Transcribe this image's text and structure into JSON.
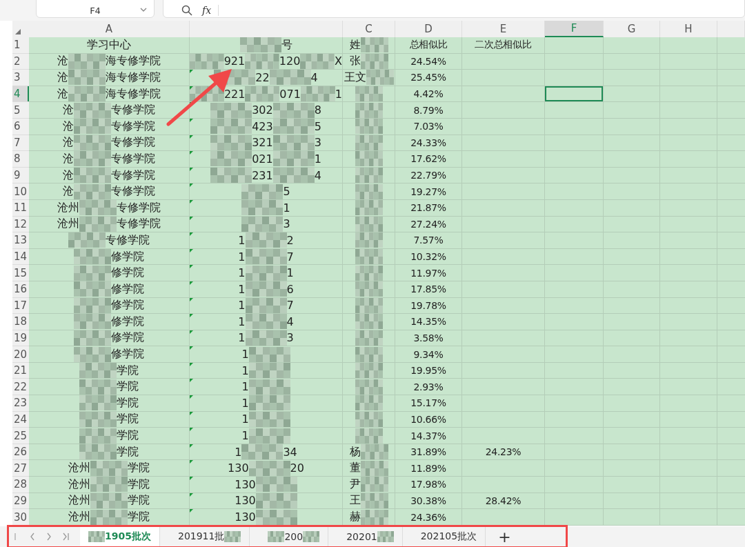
{
  "toolbar": {
    "name_box": "F4",
    "formula_label": "fx"
  },
  "columns": [
    {
      "label": "A",
      "selected": false
    },
    {
      "selected": false
    },
    {
      "label": "C",
      "selected": false
    },
    {
      "label": "D",
      "selected": false
    },
    {
      "label": "E",
      "selected": false
    },
    {
      "label": "F",
      "selected": true
    },
    {
      "label": "G",
      "selected": false
    },
    {
      "label": "H",
      "selected": false
    }
  ],
  "rows": [
    {
      "num": "1",
      "selected": false,
      "flag": false,
      "a": [
        {
          "kind": "text",
          "text": "学习中心"
        }
      ],
      "b": [
        {
          "kind": "mosaic"
        },
        {
          "kind": "text",
          "text": "号"
        }
      ],
      "c": [
        {
          "kind": "text",
          "text": "姓"
        },
        {
          "kind": "mosaic"
        }
      ],
      "d": "总相似比",
      "e": "二次总相似比"
    },
    {
      "num": "2",
      "selected": false,
      "flag": false,
      "a": [
        {
          "kind": "text",
          "text": "沧"
        },
        {
          "kind": "mosaic"
        },
        {
          "kind": "text",
          "text": "海专修学院"
        }
      ],
      "b": [
        {
          "kind": "mosaic"
        },
        {
          "kind": "text",
          "text": "921"
        },
        {
          "kind": "mosaic"
        },
        {
          "kind": "text",
          "text": "120"
        },
        {
          "kind": "mosaic"
        },
        {
          "kind": "text",
          "text": "X"
        }
      ],
      "c": [
        {
          "kind": "text",
          "text": "张"
        },
        {
          "kind": "mosaic"
        }
      ],
      "d": "24.54%"
    },
    {
      "num": "3",
      "selected": false,
      "flag": true,
      "a": [
        {
          "kind": "text",
          "text": "沧"
        },
        {
          "kind": "mosaic"
        },
        {
          "kind": "text",
          "text": "海专修学院"
        }
      ],
      "b": [
        {
          "kind": "mosaic"
        },
        {
          "kind": "text",
          "text": "22"
        },
        {
          "kind": "mosaic"
        },
        {
          "kind": "text",
          "text": "4"
        }
      ],
      "c": [
        {
          "kind": "text",
          "text": "王文"
        },
        {
          "kind": "mosaic"
        }
      ],
      "d": "25.45%"
    },
    {
      "num": "4",
      "selected": true,
      "flag": true,
      "a": [
        {
          "kind": "text",
          "text": "沧"
        },
        {
          "kind": "mosaic"
        },
        {
          "kind": "text",
          "text": "海专修学院"
        }
      ],
      "b": [
        {
          "kind": "mosaic"
        },
        {
          "kind": "text",
          "text": "221"
        },
        {
          "kind": "mosaic"
        },
        {
          "kind": "text",
          "text": "071"
        },
        {
          "kind": "mosaic"
        },
        {
          "kind": "text",
          "text": "1"
        }
      ],
      "c": [
        {
          "kind": "mosaic"
        }
      ],
      "d": "4.42%"
    },
    {
      "num": "5",
      "selected": false,
      "flag": true,
      "a": [
        {
          "kind": "text",
          "text": "沧"
        },
        {
          "kind": "mosaic"
        },
        {
          "kind": "text",
          "text": "专修学院"
        }
      ],
      "b": [
        {
          "kind": "mosaic"
        },
        {
          "kind": "text",
          "text": "302"
        },
        {
          "kind": "mosaic"
        },
        {
          "kind": "text",
          "text": "8"
        }
      ],
      "c": [
        {
          "kind": "mosaic"
        }
      ],
      "d": "8.79%"
    },
    {
      "num": "6",
      "selected": false,
      "flag": true,
      "a": [
        {
          "kind": "text",
          "text": "沧"
        },
        {
          "kind": "mosaic"
        },
        {
          "kind": "text",
          "text": "专修学院"
        }
      ],
      "b": [
        {
          "kind": "mosaic"
        },
        {
          "kind": "text",
          "text": "423"
        },
        {
          "kind": "mosaic"
        },
        {
          "kind": "text",
          "text": "5"
        }
      ],
      "c": [
        {
          "kind": "mosaic"
        }
      ],
      "d": "7.03%"
    },
    {
      "num": "7",
      "selected": false,
      "flag": true,
      "a": [
        {
          "kind": "text",
          "text": "沧"
        },
        {
          "kind": "mosaic"
        },
        {
          "kind": "text",
          "text": "专修学院"
        }
      ],
      "b": [
        {
          "kind": "mosaic"
        },
        {
          "kind": "text",
          "text": "321"
        },
        {
          "kind": "mosaic"
        },
        {
          "kind": "text",
          "text": "3"
        }
      ],
      "c": [
        {
          "kind": "mosaic"
        }
      ],
      "d": "24.33%"
    },
    {
      "num": "8",
      "selected": false,
      "flag": true,
      "a": [
        {
          "kind": "text",
          "text": "沧"
        },
        {
          "kind": "mosaic"
        },
        {
          "kind": "text",
          "text": "专修学院"
        }
      ],
      "b": [
        {
          "kind": "mosaic"
        },
        {
          "kind": "text",
          "text": "021"
        },
        {
          "kind": "mosaic"
        },
        {
          "kind": "text",
          "text": "1"
        }
      ],
      "c": [
        {
          "kind": "mosaic"
        }
      ],
      "d": "17.62%"
    },
    {
      "num": "9",
      "selected": false,
      "flag": true,
      "a": [
        {
          "kind": "text",
          "text": "沧"
        },
        {
          "kind": "mosaic"
        },
        {
          "kind": "text",
          "text": "专修学院"
        }
      ],
      "b": [
        {
          "kind": "mosaic"
        },
        {
          "kind": "text",
          "text": "231"
        },
        {
          "kind": "mosaic"
        },
        {
          "kind": "text",
          "text": "4"
        }
      ],
      "c": [
        {
          "kind": "mosaic"
        }
      ],
      "d": "22.79%"
    },
    {
      "num": "10",
      "selected": false,
      "flag": true,
      "a": [
        {
          "kind": "text",
          "text": "沧"
        },
        {
          "kind": "mosaic"
        },
        {
          "kind": "text",
          "text": "专修学院"
        }
      ],
      "b": [
        {
          "kind": "mosaic"
        },
        {
          "kind": "text",
          "text": "5"
        }
      ],
      "c": [
        {
          "kind": "mosaic"
        }
      ],
      "d": "19.27%"
    },
    {
      "num": "11",
      "selected": false,
      "flag": true,
      "a": [
        {
          "kind": "text",
          "text": "沧州"
        },
        {
          "kind": "mosaic"
        },
        {
          "kind": "text",
          "text": "专修学院"
        }
      ],
      "b": [
        {
          "kind": "mosaic"
        },
        {
          "kind": "text",
          "text": "1"
        }
      ],
      "c": [
        {
          "kind": "mosaic"
        }
      ],
      "d": "21.87%"
    },
    {
      "num": "12",
      "selected": false,
      "flag": true,
      "a": [
        {
          "kind": "text",
          "text": "沧州"
        },
        {
          "kind": "mosaic"
        },
        {
          "kind": "text",
          "text": "专修学院"
        }
      ],
      "b": [
        {
          "kind": "mosaic"
        },
        {
          "kind": "text",
          "text": "3"
        }
      ],
      "c": [
        {
          "kind": "mosaic"
        }
      ],
      "d": "27.24%"
    },
    {
      "num": "13",
      "selected": false,
      "flag": true,
      "a": [
        {
          "kind": "mosaic"
        },
        {
          "kind": "text",
          "text": "专修学院"
        }
      ],
      "b": [
        {
          "kind": "text",
          "text": "1"
        },
        {
          "kind": "mosaic"
        },
        {
          "kind": "text",
          "text": "2"
        }
      ],
      "c": [
        {
          "kind": "mosaic"
        }
      ],
      "d": "7.57%"
    },
    {
      "num": "14",
      "selected": false,
      "flag": true,
      "a": [
        {
          "kind": "mosaic"
        },
        {
          "kind": "text",
          "text": "修学院"
        }
      ],
      "b": [
        {
          "kind": "text",
          "text": "1"
        },
        {
          "kind": "mosaic"
        },
        {
          "kind": "text",
          "text": "7"
        }
      ],
      "c": [
        {
          "kind": "mosaic"
        }
      ],
      "d": "10.32%"
    },
    {
      "num": "15",
      "selected": false,
      "flag": true,
      "a": [
        {
          "kind": "mosaic"
        },
        {
          "kind": "text",
          "text": "修学院"
        }
      ],
      "b": [
        {
          "kind": "text",
          "text": "1"
        },
        {
          "kind": "mosaic"
        },
        {
          "kind": "text",
          "text": "1"
        }
      ],
      "c": [
        {
          "kind": "mosaic"
        }
      ],
      "d": "11.97%"
    },
    {
      "num": "16",
      "selected": false,
      "flag": true,
      "a": [
        {
          "kind": "mosaic"
        },
        {
          "kind": "text",
          "text": "修学院"
        }
      ],
      "b": [
        {
          "kind": "text",
          "text": "1"
        },
        {
          "kind": "mosaic"
        },
        {
          "kind": "text",
          "text": "6"
        }
      ],
      "c": [
        {
          "kind": "mosaic"
        }
      ],
      "d": "17.85%"
    },
    {
      "num": "17",
      "selected": false,
      "flag": true,
      "a": [
        {
          "kind": "mosaic"
        },
        {
          "kind": "text",
          "text": "修学院"
        }
      ],
      "b": [
        {
          "kind": "text",
          "text": "1"
        },
        {
          "kind": "mosaic"
        },
        {
          "kind": "text",
          "text": "7"
        }
      ],
      "c": [
        {
          "kind": "mosaic"
        }
      ],
      "d": "19.78%"
    },
    {
      "num": "18",
      "selected": false,
      "flag": true,
      "a": [
        {
          "kind": "mosaic"
        },
        {
          "kind": "text",
          "text": "修学院"
        }
      ],
      "b": [
        {
          "kind": "text",
          "text": "1"
        },
        {
          "kind": "mosaic"
        },
        {
          "kind": "text",
          "text": "4"
        }
      ],
      "c": [
        {
          "kind": "mosaic"
        }
      ],
      "d": "14.35%"
    },
    {
      "num": "19",
      "selected": false,
      "flag": true,
      "a": [
        {
          "kind": "mosaic"
        },
        {
          "kind": "text",
          "text": "修学院"
        }
      ],
      "b": [
        {
          "kind": "text",
          "text": "1"
        },
        {
          "kind": "mosaic"
        },
        {
          "kind": "text",
          "text": "3"
        }
      ],
      "c": [
        {
          "kind": "mosaic"
        }
      ],
      "d": "3.58%"
    },
    {
      "num": "20",
      "selected": false,
      "flag": true,
      "a": [
        {
          "kind": "mosaic"
        },
        {
          "kind": "text",
          "text": "修学院"
        }
      ],
      "b": [
        {
          "kind": "text",
          "text": "1"
        },
        {
          "kind": "mosaic"
        }
      ],
      "c": [
        {
          "kind": "mosaic"
        }
      ],
      "d": "9.34%"
    },
    {
      "num": "21",
      "selected": false,
      "flag": true,
      "a": [
        {
          "kind": "mosaic"
        },
        {
          "kind": "text",
          "text": "学院"
        }
      ],
      "b": [
        {
          "kind": "text",
          "text": "1"
        },
        {
          "kind": "mosaic"
        }
      ],
      "c": [
        {
          "kind": "mosaic"
        }
      ],
      "d": "19.95%"
    },
    {
      "num": "22",
      "selected": false,
      "flag": true,
      "a": [
        {
          "kind": "mosaic"
        },
        {
          "kind": "text",
          "text": "学院"
        }
      ],
      "b": [
        {
          "kind": "text",
          "text": "1"
        },
        {
          "kind": "mosaic"
        }
      ],
      "c": [
        {
          "kind": "mosaic"
        }
      ],
      "d": "2.93%"
    },
    {
      "num": "23",
      "selected": false,
      "flag": true,
      "a": [
        {
          "kind": "mosaic"
        },
        {
          "kind": "text",
          "text": "学院"
        }
      ],
      "b": [
        {
          "kind": "text",
          "text": "1"
        },
        {
          "kind": "mosaic"
        }
      ],
      "c": [
        {
          "kind": "mosaic"
        }
      ],
      "d": "15.17%"
    },
    {
      "num": "24",
      "selected": false,
      "flag": true,
      "a": [
        {
          "kind": "mosaic"
        },
        {
          "kind": "text",
          "text": "学院"
        }
      ],
      "b": [
        {
          "kind": "text",
          "text": "1"
        },
        {
          "kind": "mosaic"
        }
      ],
      "c": [
        {
          "kind": "mosaic"
        }
      ],
      "d": "10.66%"
    },
    {
      "num": "25",
      "selected": false,
      "flag": true,
      "a": [
        {
          "kind": "mosaic"
        },
        {
          "kind": "text",
          "text": "学院"
        }
      ],
      "b": [
        {
          "kind": "text",
          "text": "1"
        },
        {
          "kind": "mosaic"
        }
      ],
      "c": [
        {
          "kind": "mosaic"
        }
      ],
      "d": "14.37%"
    },
    {
      "num": "26",
      "selected": false,
      "flag": true,
      "a": [
        {
          "kind": "mosaic"
        },
        {
          "kind": "text",
          "text": "学院"
        }
      ],
      "b": [
        {
          "kind": "text",
          "text": "1"
        },
        {
          "kind": "mosaic"
        },
        {
          "kind": "text",
          "text": "34"
        }
      ],
      "c": [
        {
          "kind": "text",
          "text": "杨"
        },
        {
          "kind": "mosaic"
        }
      ],
      "d": "31.89%",
      "e": "24.23%"
    },
    {
      "num": "27",
      "selected": false,
      "flag": true,
      "a": [
        {
          "kind": "text",
          "text": "沧州"
        },
        {
          "kind": "mosaic"
        },
        {
          "kind": "text",
          "text": "学院"
        }
      ],
      "b": [
        {
          "kind": "text",
          "text": "130"
        },
        {
          "kind": "mosaic"
        },
        {
          "kind": "text",
          "text": "20"
        }
      ],
      "c": [
        {
          "kind": "text",
          "text": "董"
        },
        {
          "kind": "mosaic"
        }
      ],
      "d": "11.89%"
    },
    {
      "num": "28",
      "selected": false,
      "flag": true,
      "a": [
        {
          "kind": "text",
          "text": "沧州"
        },
        {
          "kind": "mosaic"
        },
        {
          "kind": "text",
          "text": "学院"
        }
      ],
      "b": [
        {
          "kind": "text",
          "text": "130"
        },
        {
          "kind": "mosaic"
        }
      ],
      "c": [
        {
          "kind": "text",
          "text": "尹"
        },
        {
          "kind": "mosaic"
        }
      ],
      "d": "17.98%"
    },
    {
      "num": "29",
      "selected": false,
      "flag": true,
      "a": [
        {
          "kind": "text",
          "text": "沧州"
        },
        {
          "kind": "mosaic"
        },
        {
          "kind": "text",
          "text": "学院"
        }
      ],
      "b": [
        {
          "kind": "text",
          "text": "130"
        },
        {
          "kind": "mosaic"
        }
      ],
      "c": [
        {
          "kind": "text",
          "text": "王"
        },
        {
          "kind": "mosaic"
        }
      ],
      "d": "30.38%",
      "e": "28.42%"
    },
    {
      "num": "30",
      "selected": false,
      "flag": true,
      "a": [
        {
          "kind": "text",
          "text": "沧州"
        },
        {
          "kind": "mosaic"
        },
        {
          "kind": "text",
          "text": "学院"
        }
      ],
      "b": [
        {
          "kind": "text",
          "text": "130"
        },
        {
          "kind": "mosaic"
        }
      ],
      "c": [
        {
          "kind": "text",
          "text": "赫"
        },
        {
          "kind": "mosaic"
        }
      ],
      "d": "24.36%"
    }
  ],
  "sheet_tabs": [
    {
      "selected": true,
      "segments": [
        {
          "kind": "mosaic"
        },
        {
          "kind": "text",
          "text": "1905批次"
        }
      ]
    },
    {
      "selected": false,
      "segments": [
        {
          "kind": "text",
          "text": "201911批"
        },
        {
          "kind": "mosaic"
        }
      ]
    },
    {
      "selected": false,
      "segments": [
        {
          "kind": "mosaic"
        },
        {
          "kind": "text",
          "text": "200"
        },
        {
          "kind": "mosaic"
        }
      ]
    },
    {
      "selected": false,
      "segments": [
        {
          "kind": "text",
          "text": "20201"
        },
        {
          "kind": "mosaic"
        }
      ]
    },
    {
      "selected": false,
      "segments": [
        {
          "kind": "text",
          "text": "202105批次"
        }
      ]
    }
  ],
  "add_sheet": "+"
}
